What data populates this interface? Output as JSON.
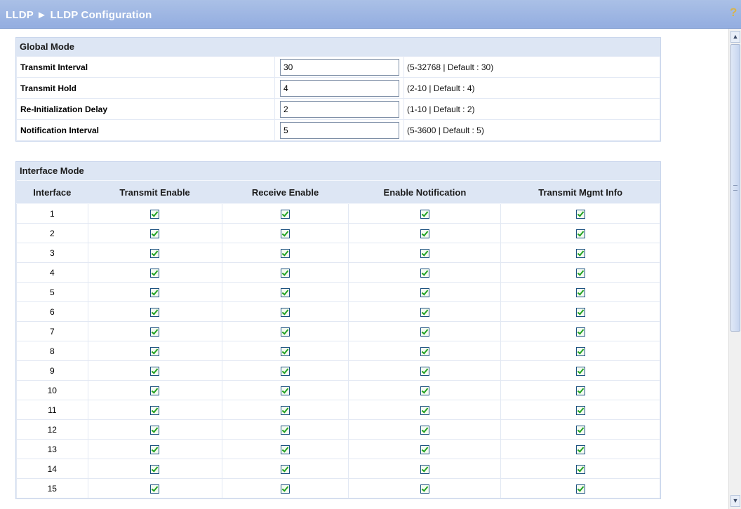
{
  "header": {
    "breadcrumb": "LLDP ► LLDP Configuration",
    "help_icon": "help-icon"
  },
  "global_mode": {
    "title": "Global Mode",
    "fields": [
      {
        "label": "Transmit Interval",
        "value": "30",
        "range": "(5-32768 | Default : 30)"
      },
      {
        "label": "Transmit Hold",
        "value": "4",
        "range": "(2-10 | Default : 4)"
      },
      {
        "label": "Re-Initialization Delay",
        "value": "2",
        "range": "(1-10 | Default : 2)"
      },
      {
        "label": "Notification Interval",
        "value": "5",
        "range": "(5-3600 | Default : 5)"
      }
    ]
  },
  "interface_mode": {
    "title": "Interface Mode",
    "columns": [
      "Interface",
      "Transmit Enable",
      "Receive Enable",
      "Enable Notification",
      "Transmit Mgmt Info"
    ],
    "rows": [
      {
        "interface": "1",
        "checked": [
          true,
          true,
          true,
          true
        ]
      },
      {
        "interface": "2",
        "checked": [
          true,
          true,
          true,
          true
        ]
      },
      {
        "interface": "3",
        "checked": [
          true,
          true,
          true,
          true
        ]
      },
      {
        "interface": "4",
        "checked": [
          true,
          true,
          true,
          true
        ]
      },
      {
        "interface": "5",
        "checked": [
          true,
          true,
          true,
          true
        ]
      },
      {
        "interface": "6",
        "checked": [
          true,
          true,
          true,
          true
        ]
      },
      {
        "interface": "7",
        "checked": [
          true,
          true,
          true,
          true
        ]
      },
      {
        "interface": "8",
        "checked": [
          true,
          true,
          true,
          true
        ]
      },
      {
        "interface": "9",
        "checked": [
          true,
          true,
          true,
          true
        ]
      },
      {
        "interface": "10",
        "checked": [
          true,
          true,
          true,
          true
        ]
      },
      {
        "interface": "11",
        "checked": [
          true,
          true,
          true,
          true
        ]
      },
      {
        "interface": "12",
        "checked": [
          true,
          true,
          true,
          true
        ]
      },
      {
        "interface": "13",
        "checked": [
          true,
          true,
          true,
          true
        ]
      },
      {
        "interface": "14",
        "checked": [
          true,
          true,
          true,
          true
        ]
      },
      {
        "interface": "15",
        "checked": [
          true,
          true,
          true,
          true
        ]
      }
    ]
  },
  "colors": {
    "header_bg": "#93ade0",
    "panel_bg": "#dde6f4",
    "check_color": "#21a121"
  }
}
